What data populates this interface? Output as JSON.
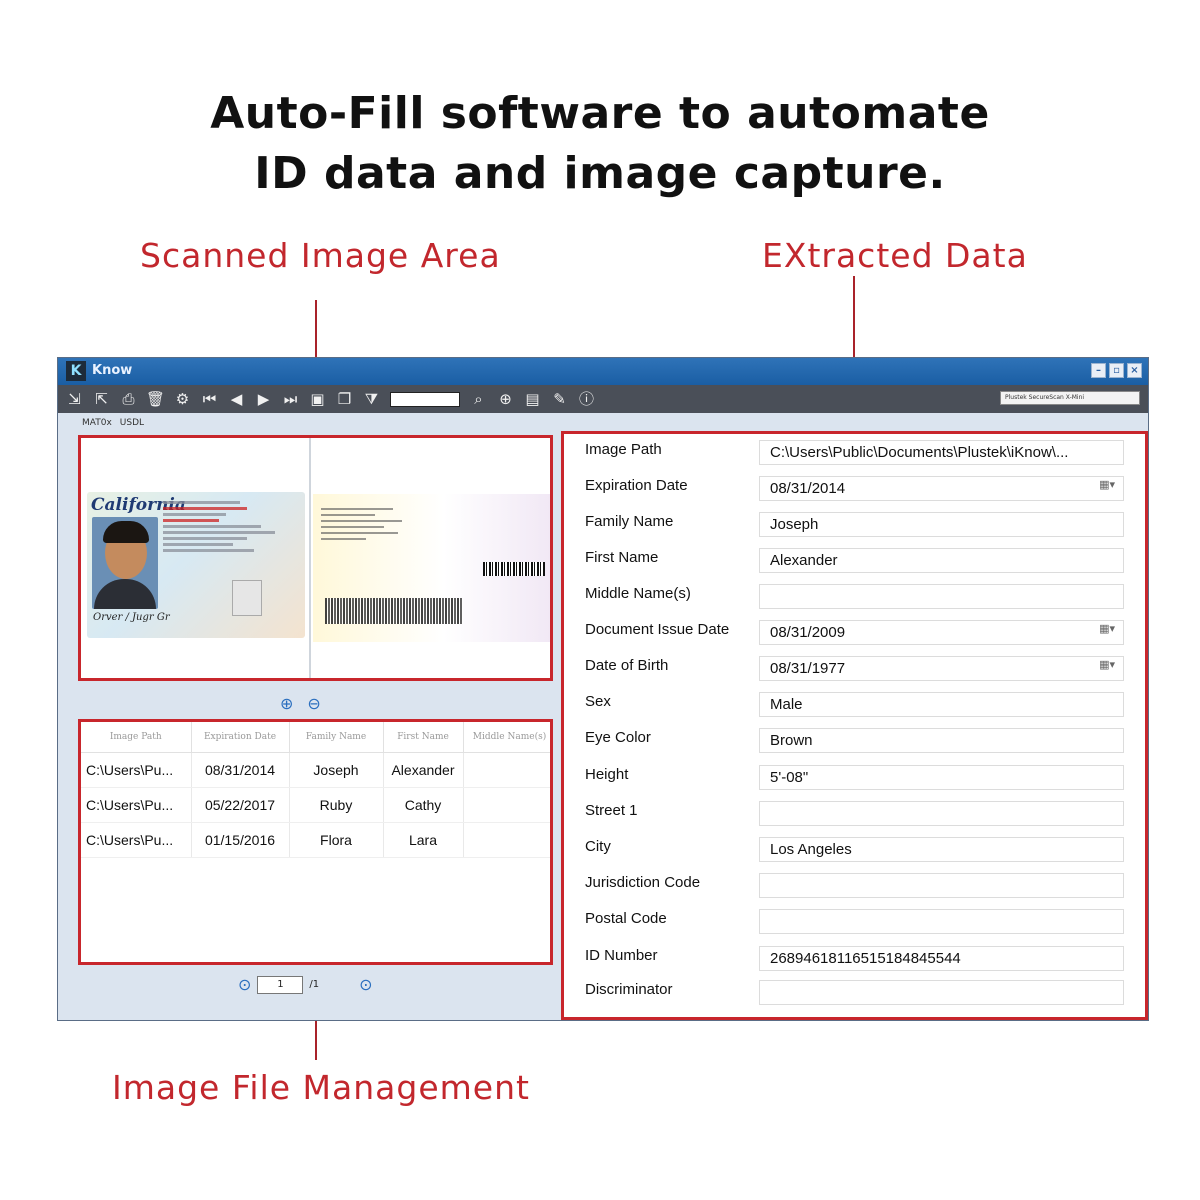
{
  "headline": {
    "line1": "Auto-Fill software to automate",
    "line2": "ID data and image capture."
  },
  "callouts": {
    "scanned": "Scanned Image Area",
    "extracted": "EXtracted Data",
    "files": "Image File Management"
  },
  "window": {
    "title": "Know",
    "logo_letter": "K",
    "select_value": "Plustek SecureScan X-Mini",
    "subtabs": [
      "MAT0x",
      "USDL"
    ]
  },
  "scan": {
    "state": "California",
    "signature": "Orver / Jugr Gr"
  },
  "files_table": {
    "headers": [
      "Image Path",
      "Expiration Date",
      "Family Name",
      "First Name",
      "Middle Name(s)"
    ],
    "rows": [
      [
        "C:\\Users\\Pu...",
        "08/31/2014",
        "Joseph",
        "Alexander",
        ""
      ],
      [
        "C:\\Users\\Pu...",
        "05/22/2017",
        "Ruby",
        "Cathy",
        ""
      ],
      [
        "C:\\Users\\Pu...",
        "01/15/2016",
        "Flora",
        "Lara",
        ""
      ]
    ]
  },
  "pager": {
    "current": "1",
    "total": "/1"
  },
  "fields": [
    {
      "label": "Image Path",
      "value": "C:\\Users\\Public\\Documents\\Plustek\\iKnow\\...",
      "date": false
    },
    {
      "label": "Expiration Date",
      "value": "08/31/2014",
      "date": true
    },
    {
      "label": "Family Name",
      "value": "Joseph",
      "date": false
    },
    {
      "label": "First Name",
      "value": "Alexander",
      "date": false
    },
    {
      "label": "Middle Name(s)",
      "value": "",
      "date": false
    },
    {
      "label": "Document Issue Date",
      "value": "08/31/2009",
      "date": true
    },
    {
      "label": "Date of Birth",
      "value": "08/31/1977",
      "date": true
    },
    {
      "label": "Sex",
      "value": "Male",
      "date": false
    },
    {
      "label": "Eye Color",
      "value": "Brown",
      "date": false
    },
    {
      "label": "Height",
      "value": "5'-08\"",
      "date": false
    },
    {
      "label": "Street 1",
      "value": "",
      "date": false
    },
    {
      "label": "City",
      "value": "Los Angeles",
      "date": false
    },
    {
      "label": "Jurisdiction Code",
      "value": "",
      "date": false
    },
    {
      "label": "Postal Code",
      "value": "",
      "date": false
    },
    {
      "label": "ID Number",
      "value": "26894618116515184845544",
      "date": false
    },
    {
      "label": "Discriminator",
      "value": "",
      "date": false
    }
  ],
  "colors": {
    "accent": "#c8262c",
    "titlebar": "#1a5ea4",
    "toolbar": "#4a4f58",
    "link": "#2b6fbf"
  }
}
